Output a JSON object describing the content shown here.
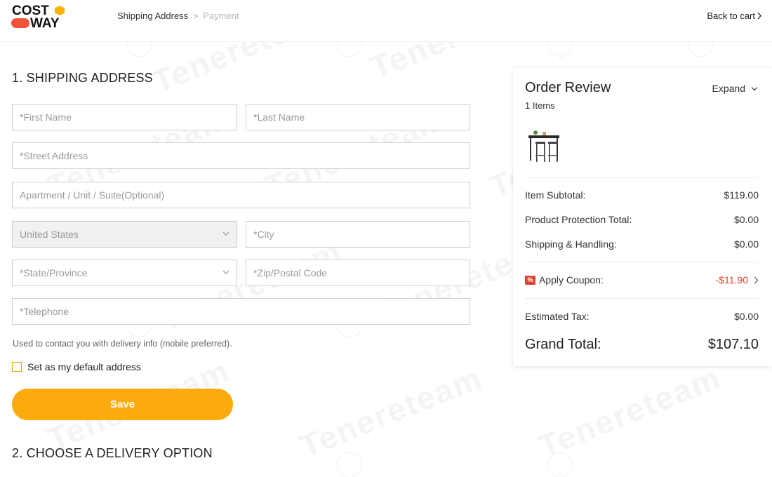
{
  "header": {
    "logo_line1": "COST",
    "logo_line2": "WAY",
    "breadcrumb_current": "Shipping Address",
    "breadcrumb_sep": ">",
    "breadcrumb_next": "Payment",
    "back_to_cart": "Back to cart"
  },
  "shipping": {
    "title": "1. SHIPPING ADDRESS",
    "first_name_placeholder": "*First Name",
    "last_name_placeholder": "*Last Name",
    "street_placeholder": "*Street Address",
    "apartment_placeholder": "Apartment / Unit / Suite(Optional)",
    "country_value": "United States",
    "city_placeholder": "*City",
    "state_placeholder": "*State/Province",
    "zip_placeholder": "*Zip/Postal Code",
    "telephone_placeholder": "*Telephone",
    "helper_text": "Used to contact you with delivery info (mobile preferred).",
    "default_address_label": "Set as my default address",
    "default_address_checked": false,
    "save_label": "Save"
  },
  "delivery": {
    "title": "2. CHOOSE A DELIVERY OPTION"
  },
  "order_review": {
    "title": "Order Review",
    "items_count": "1 Items",
    "expand_label": "Expand",
    "subtotal_label": "Item Subtotal:",
    "subtotal_value": "$119.00",
    "protection_label": "Product Protection Total:",
    "protection_value": "$0.00",
    "shipping_label": "Shipping & Handling:",
    "shipping_value": "$0.00",
    "coupon_icon": "%",
    "coupon_label": "Apply Coupon:",
    "coupon_value": "-$11.90",
    "tax_label": "Estimated Tax:",
    "tax_value": "$0.00",
    "grand_label": "Grand Total:",
    "grand_value": "$107.10"
  },
  "watermark": "Tenereteam",
  "colors": {
    "accent": "#fbab0e",
    "coupon": "#e0452f",
    "logo_orange": "#f9b300",
    "logo_red": "#f0533a"
  }
}
